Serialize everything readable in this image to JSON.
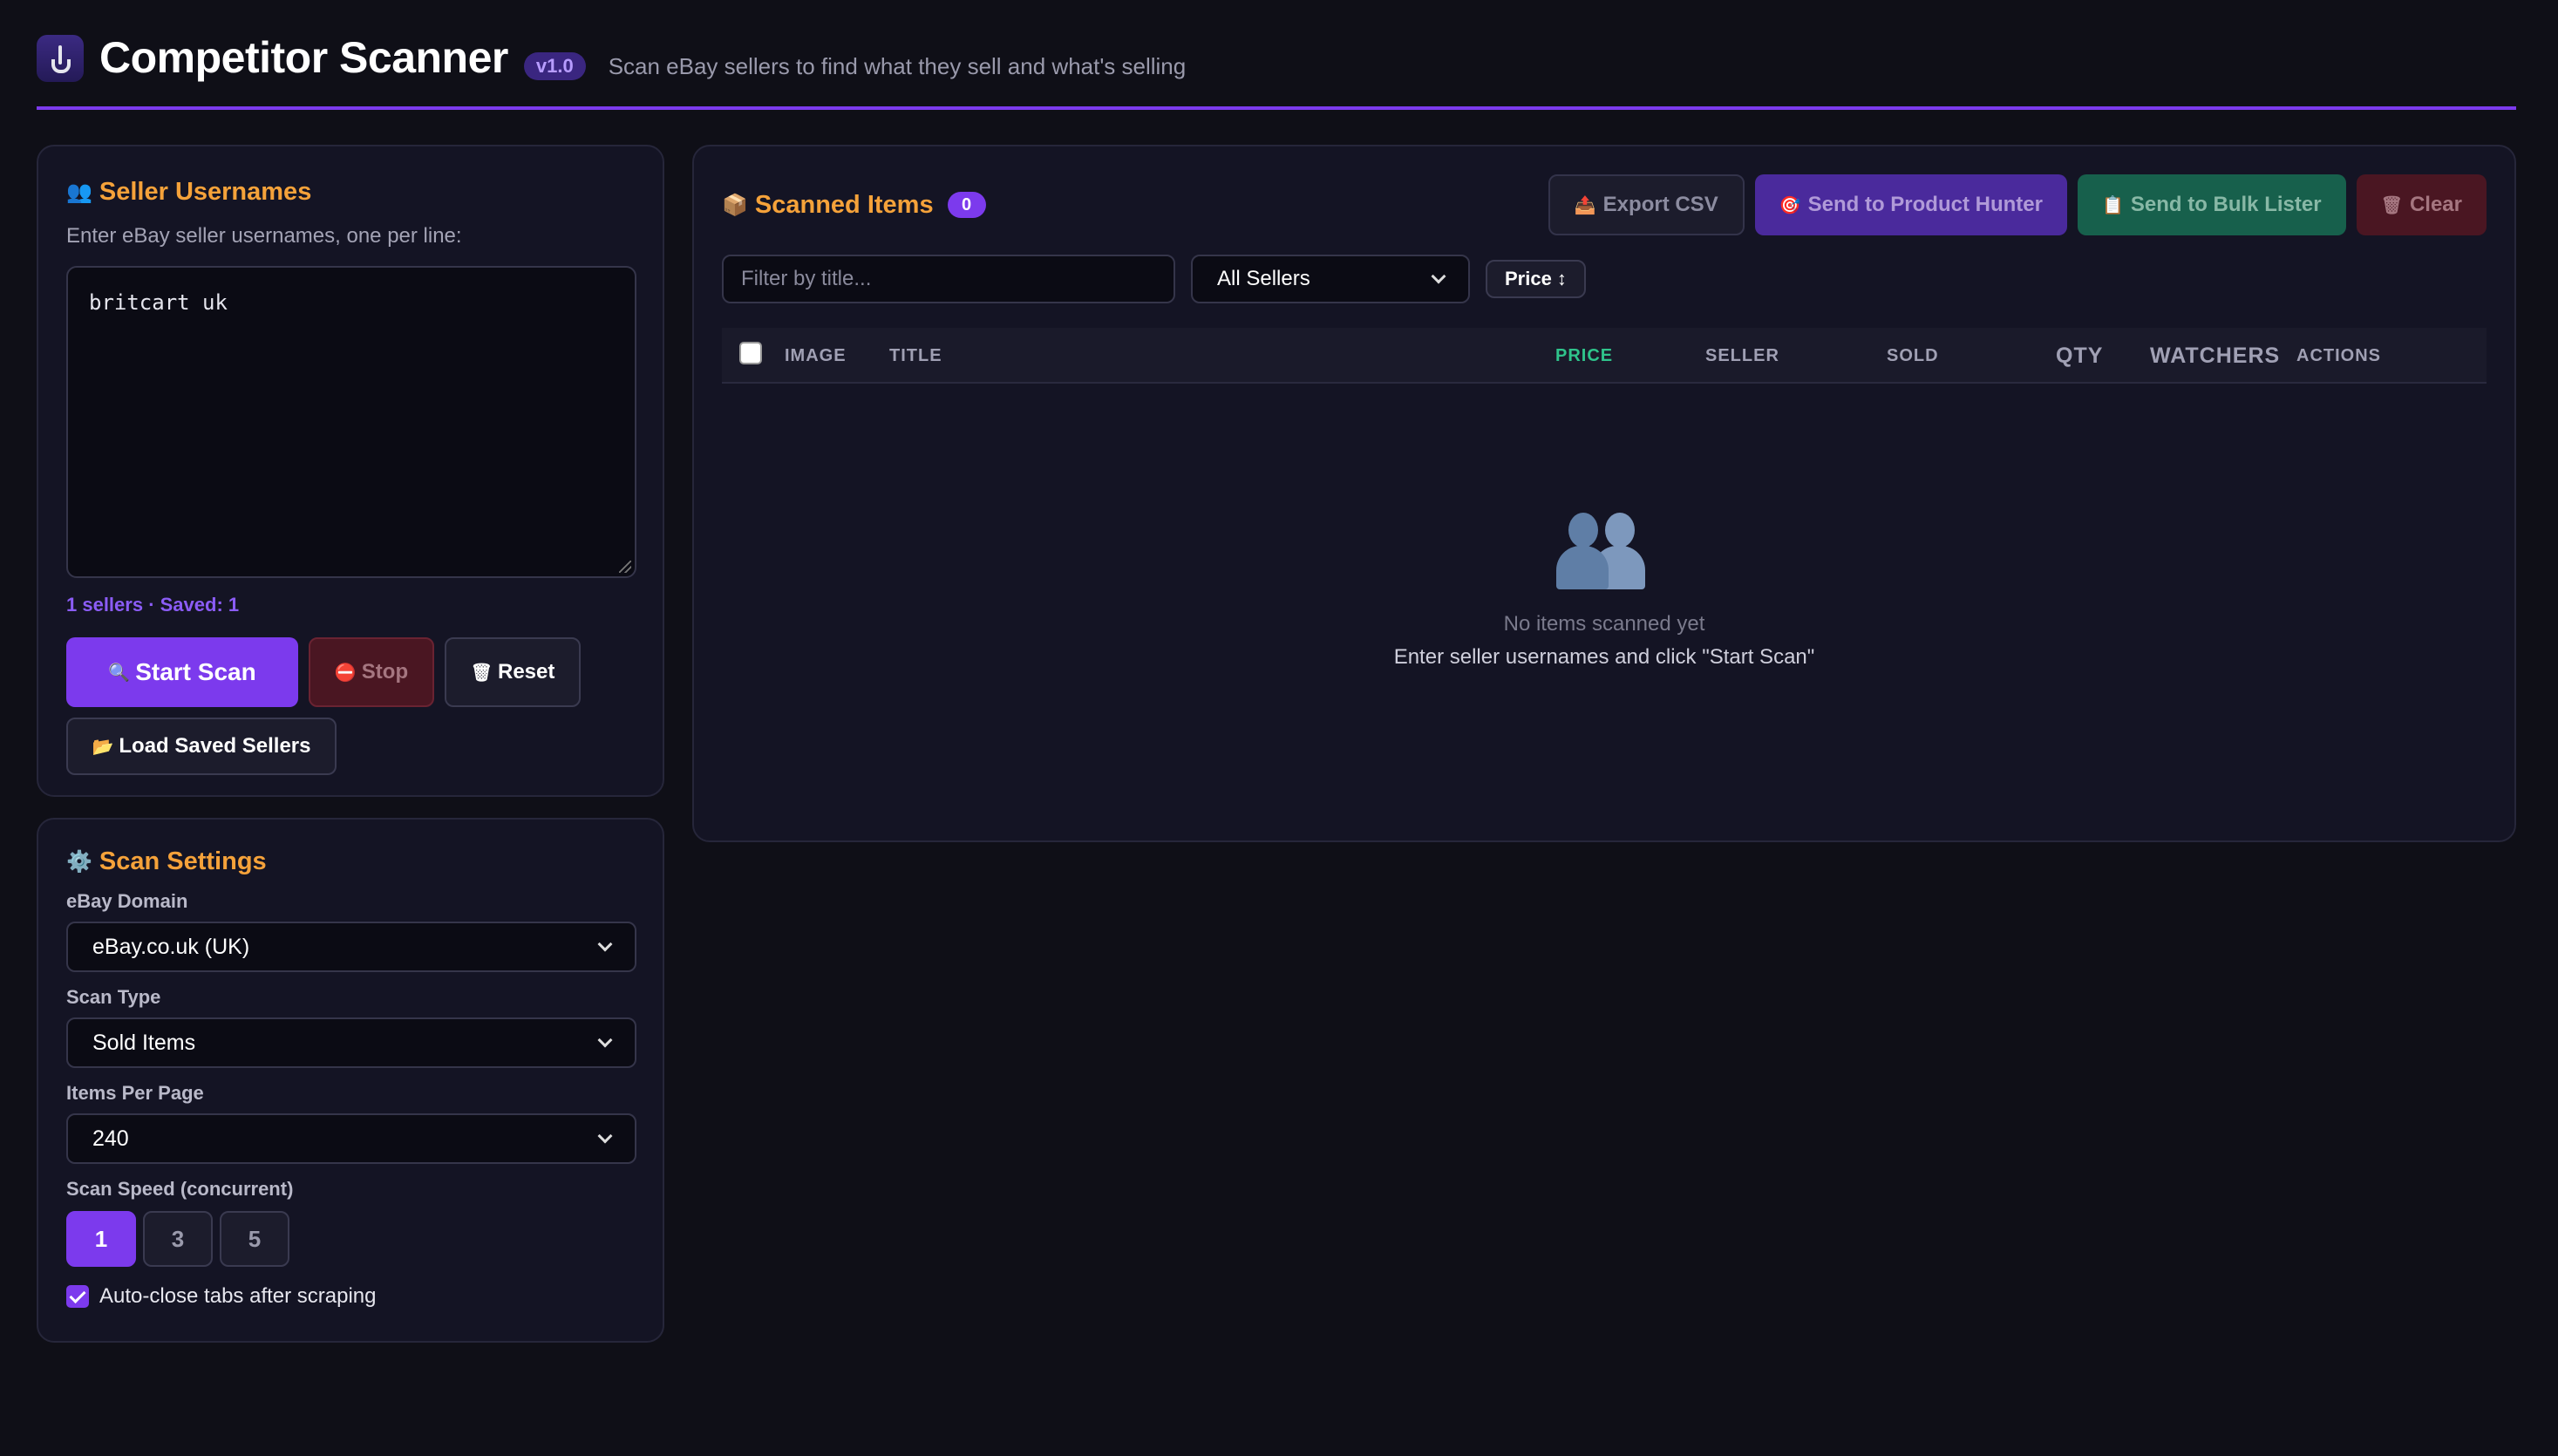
{
  "header": {
    "title": "Competitor Scanner",
    "version": "v1.0",
    "subtitle": "Scan eBay sellers to find what they sell and what's selling"
  },
  "sellers": {
    "title": "Seller Usernames",
    "title_icon": "👥",
    "hint": "Enter eBay seller usernames, one per line:",
    "textarea_value": "britcart uk",
    "count_text": "1 sellers · Saved: 1",
    "start_label": "Start Scan",
    "start_icon": "🔍",
    "stop_label": "Stop",
    "stop_icon": "⛔",
    "reset_label": "Reset",
    "reset_icon": "🗑",
    "load_label": "Load Saved Sellers",
    "load_icon": "📂"
  },
  "settings": {
    "title": "Scan Settings",
    "title_icon": "⚙️",
    "domain_label": "eBay Domain",
    "domain_value": "eBay.co.uk (UK)",
    "scan_type_label": "Scan Type",
    "scan_type_value": "Sold Items",
    "per_page_label": "Items Per Page",
    "per_page_value": "240",
    "speed_label": "Scan Speed (concurrent)",
    "speed_options": [
      "1",
      "3",
      "5"
    ],
    "speed_selected": "1",
    "autoclose_label": "Auto-close tabs after scraping",
    "autoclose_checked": true
  },
  "items": {
    "title": "Scanned Items",
    "title_icon": "📦",
    "count": "0",
    "export_label": "Export CSV",
    "export_icon": "📤",
    "hunter_label": "Send to Product Hunter",
    "hunter_icon": "🎯",
    "bulk_label": "Send to Bulk Lister",
    "bulk_icon": "📋",
    "clear_label": "Clear",
    "clear_icon": "🗑",
    "filter_placeholder": "Filter by title...",
    "seller_filter_value": "All Sellers",
    "sort_label": "Price ↕",
    "columns": {
      "image": "IMAGE",
      "title": "TITLE",
      "price": "PRICE",
      "seller": "SELLER",
      "sold": "SOLD",
      "qty": "QTY",
      "watchers": "WATCHERS",
      "actions": "ACTIONS"
    },
    "empty_title": "No items scanned yet",
    "empty_sub": "Enter seller usernames and click \"Start Scan\""
  },
  "colors": {
    "accent": "#7c3aed",
    "heading": "#f5a23a",
    "background": "#0f0f17",
    "panel": "#141424",
    "price_header": "#2fc38b"
  }
}
